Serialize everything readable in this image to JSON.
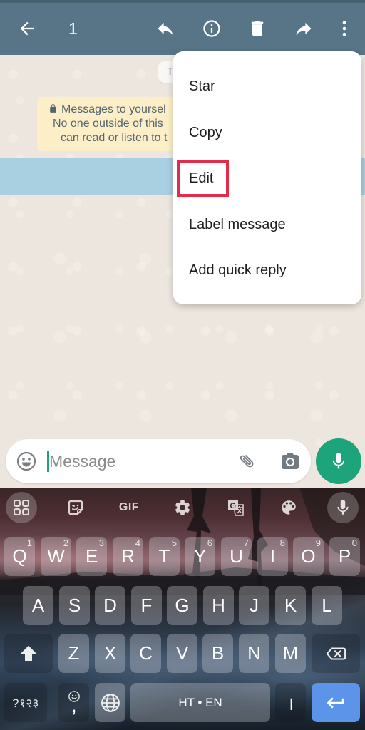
{
  "header": {
    "selected_count": "1",
    "icons": [
      "arrow-back",
      "reply",
      "info",
      "delete",
      "forward",
      "more-vert"
    ]
  },
  "chat": {
    "date_chip": "Today",
    "system_message": {
      "icon": "lock",
      "lines": [
        "Messages to yoursel",
        "No one outside of this",
        "can read or listen to t"
      ]
    },
    "selected_message_count": 1
  },
  "context_menu": {
    "items": [
      "Star",
      "Copy",
      "Edit",
      "Label message",
      "Add quick reply"
    ],
    "highlighted_item": "Edit"
  },
  "composer": {
    "placeholder": "Message",
    "icons": [
      "emoji",
      "attach",
      "camera",
      "mic"
    ]
  },
  "keyboard": {
    "toolbar": {
      "icons": [
        "apps",
        "sticker",
        "gif",
        "settings",
        "translate",
        "theme-palette",
        "voice-input"
      ],
      "gif_label": "GIF"
    },
    "row1": [
      {
        "letter": "Q",
        "hint": "1"
      },
      {
        "letter": "W",
        "hint": "2"
      },
      {
        "letter": "E",
        "hint": "3"
      },
      {
        "letter": "R",
        "hint": "4"
      },
      {
        "letter": "T",
        "hint": "5"
      },
      {
        "letter": "Y",
        "hint": "6"
      },
      {
        "letter": "U",
        "hint": "7"
      },
      {
        "letter": "I",
        "hint": "8"
      },
      {
        "letter": "O",
        "hint": "9"
      },
      {
        "letter": "P",
        "hint": "0"
      }
    ],
    "row2": [
      "A",
      "S",
      "D",
      "F",
      "G",
      "H",
      "J",
      "K",
      "L"
    ],
    "row3": [
      "Z",
      "X",
      "C",
      "V",
      "B",
      "N",
      "M"
    ],
    "symbols_label": "?१२३",
    "comma_label": ",",
    "space_label": "HT • EN",
    "period_label": "।"
  },
  "colors": {
    "header": "#577586",
    "chat_background": "#ede6df",
    "selected_highlight": "#a8d0e1",
    "system_bubble": "#fcefc7",
    "accent_green": "#1da47b",
    "annotation_red": "#e32b4b",
    "enter_key": "#5b94e8"
  }
}
